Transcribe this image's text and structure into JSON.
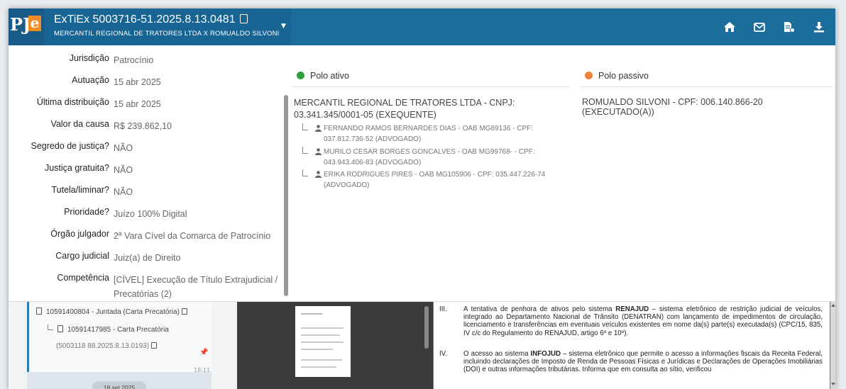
{
  "header": {
    "logo_text": "PJ",
    "logo_e": "e",
    "process_number": "ExTiEx 5003716-51.2025.8.13.0481",
    "parties": "MERCANTIL REGIONAL DE TRATORES LTDA X ROMUALDO SILVONI",
    "brand_color": "#1b6d9c",
    "icons": [
      "home-icon",
      "mail-icon",
      "document-icon",
      "download-icon"
    ]
  },
  "details": [
    {
      "label": "Jurisdição",
      "value": "Patrocínio"
    },
    {
      "label": "Autuação",
      "value": "15 abr 2025"
    },
    {
      "label": "Última distribuição",
      "value": "15 abr 2025"
    },
    {
      "label": "Valor da causa",
      "value": "R$ 239.862,10"
    },
    {
      "label": "Segredo de justiça?",
      "value": "NÃO"
    },
    {
      "label": "Justiça gratuita?",
      "value": "NÃO"
    },
    {
      "label": "Tutela/liminar?",
      "value": "NÃO"
    },
    {
      "label": "Prioridade?",
      "value": "Juízo 100% Digital"
    },
    {
      "label": "Órgão julgador",
      "value": "2ª Vara Cível da Comarca de Patrocínio"
    },
    {
      "label": "Cargo judicial",
      "value": "Juiz(a) de Direito"
    },
    {
      "label": "Competência",
      "value": "[CÍVEL] Execução de Título Extrajudicial / Precatórias (2)"
    }
  ],
  "polo_ativo": {
    "title": "Polo ativo",
    "color": "#2e9e3e",
    "party": "MERCANTIL REGIONAL DE TRATORES LTDA - CNPJ: 03.341.345/0001-05 (EXEQUENTE)",
    "lawyers": [
      "FERNANDO RAMOS BERNARDES DIAS - OAB MG89136 - CPF: 037.812.736-52 (ADVOGADO)",
      "MURILO CESAR BORGES GONCALVES - OAB MG99768- - CPF: 043.943.406-83 (ADVOGADO)",
      "ERIKA RODRIGUES PIRES - OAB MG105906 - CPF: 035.447.226-74 (ADVOGADO)"
    ]
  },
  "polo_passivo": {
    "title": "Polo passivo",
    "color": "#f07f3c",
    "party": "ROMUALDO SILVONI - CPF: 006.140.866-20 (EXECUTADO(A))"
  },
  "timeline": {
    "item1": "10591400804 - Juntada (Carta Precatória)",
    "item2": "10591417985 - Carta Precatória",
    "item2_sub": "(5003118 88.2025.8.13.0193)",
    "time": "18:11",
    "date_pill": "18 set 2025"
  },
  "document": {
    "p3_num": "III.",
    "p3_pre": "A tentativa de penhora de ativos pelo sistema ",
    "p3_bold": "RENAJUD",
    "p3_post": " – sistema eletrônico de restrição judicial de veículos, integrado ao Departamento Nacional de Trânsito (DENATRAN) com lançamento de impedimentos de circulação, licenciamento e transferências em eventuais veículos existentes em nome da(s) parte(s) executada(s) (CPC/15, 835, IV c/c do Regulamento do RENAJUD, artigo 6º e 10º).",
    "p4_num": "IV.",
    "p4_pre": "O acesso ao sistema ",
    "p4_bold": "INFOJUD",
    "p4_post": " – sistema eletrônico que permite o acesso a informações fiscais da Receita Federal, incluindo declarações de Imposto de Renda de Pessoas Físicas e Jurídicas e Declarações de Operações Imobiliárias (DOI) e outras informações tributárias. Informa que em consulta ao sítio, verificou"
  }
}
